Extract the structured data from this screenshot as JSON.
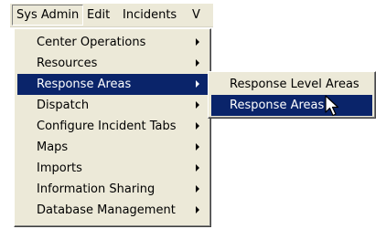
{
  "menubar": {
    "items": [
      {
        "label": "Sys Admin"
      },
      {
        "label": "Edit"
      },
      {
        "label": "Incidents"
      },
      {
        "label": "V"
      }
    ]
  },
  "sysadmin_menu": {
    "items": [
      {
        "label": "Center Operations"
      },
      {
        "label": "Resources"
      },
      {
        "label": "Response Areas"
      },
      {
        "label": "Dispatch"
      },
      {
        "label": "Configure Incident Tabs"
      },
      {
        "label": "Maps"
      },
      {
        "label": "Imports"
      },
      {
        "label": "Information Sharing"
      },
      {
        "label": "Database Management"
      }
    ],
    "selected": "Response Areas"
  },
  "response_areas_submenu": {
    "items": [
      {
        "label": "Response Level Areas"
      },
      {
        "label": "Response Areas"
      }
    ],
    "selected": "Response Areas"
  },
  "colors": {
    "menu_background": "#ece9d8",
    "selection": "#0a246a",
    "selection_text": "#ffffff"
  }
}
